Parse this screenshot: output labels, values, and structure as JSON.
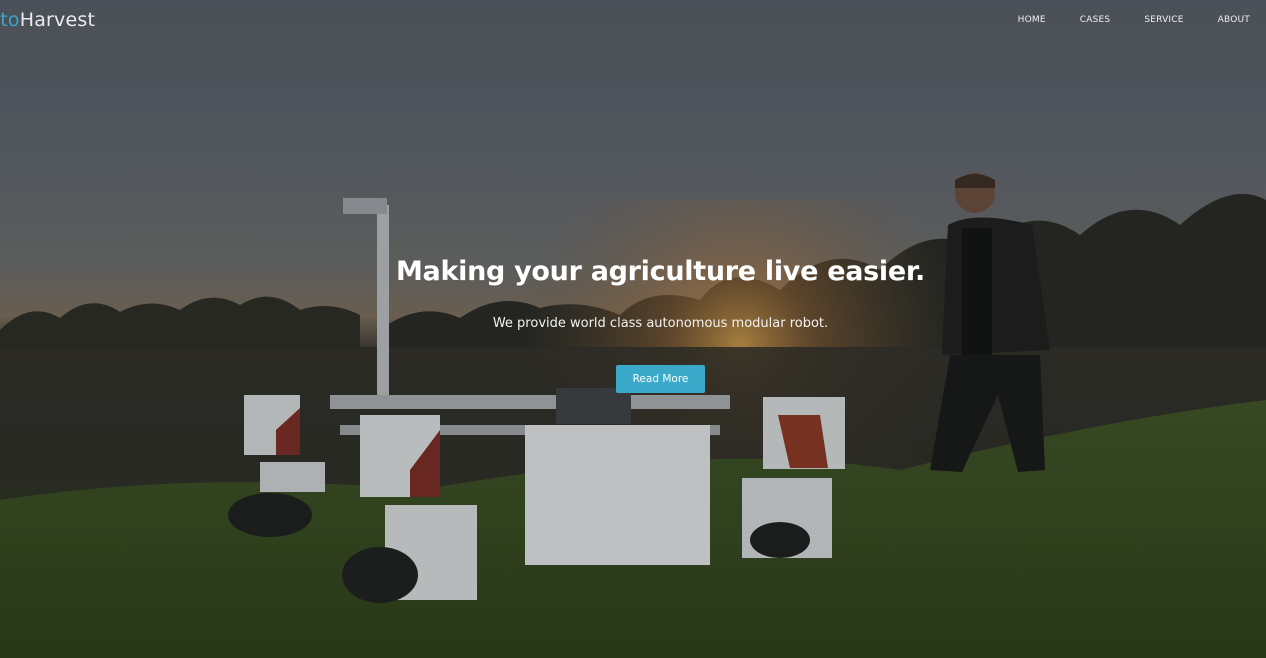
{
  "brand": {
    "part1": "uto",
    "part2": "Harvest",
    "accent_color": "#3aa6cc"
  },
  "nav": {
    "items": [
      "HOME",
      "CASES",
      "SERVICE",
      "ABOUT"
    ]
  },
  "hero": {
    "headline": "Making your agriculture live easier.",
    "subtext": "We provide world class autonomous modular robot.",
    "button_label": "Read More",
    "button_color": "#3ba9c9"
  }
}
